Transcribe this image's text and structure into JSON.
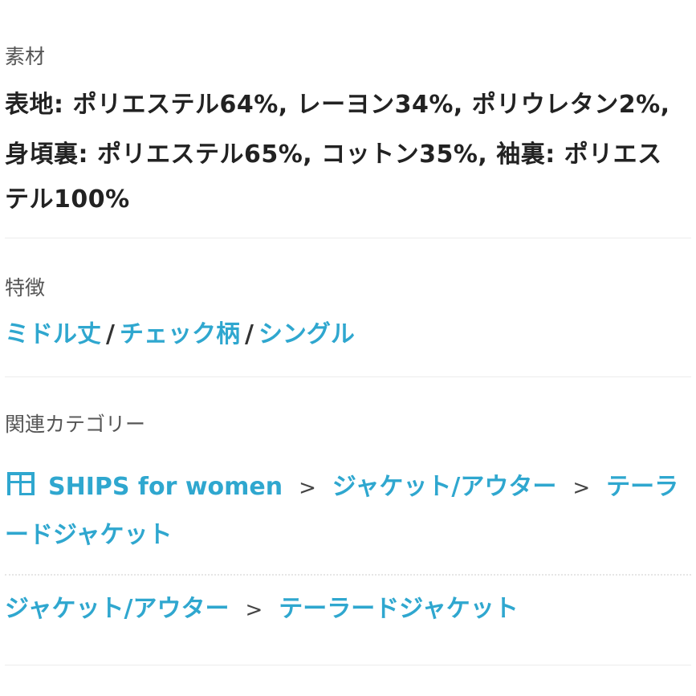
{
  "material": {
    "label": "素材",
    "line1": "表地: ポリエステル64%, レーヨン34%, ポリウレタン2%,",
    "line2": "身頃裏: ポリエステル65%, コットン35%, 袖裏: ポリエス",
    "line3": "テル100%"
  },
  "features": {
    "label": "特徴",
    "items": [
      "ミドル丈",
      "チェック柄",
      "シングル"
    ],
    "separator": "/"
  },
  "related": {
    "label": "関連カテゴリー",
    "row1": {
      "shop": "SHIPS for women",
      "cat1": "ジャケット/アウター",
      "cat2_part1": "テーラ",
      "cat2_part2": "ードジャケット"
    },
    "row2": {
      "cat1": "ジャケット/アウター",
      "cat2": "テーラードジャケット"
    },
    "arrow": ">"
  },
  "colors": {
    "link": "#2fa7cf",
    "text": "#222222",
    "label": "#555555"
  },
  "icons": {
    "shop": "shop-icon"
  }
}
